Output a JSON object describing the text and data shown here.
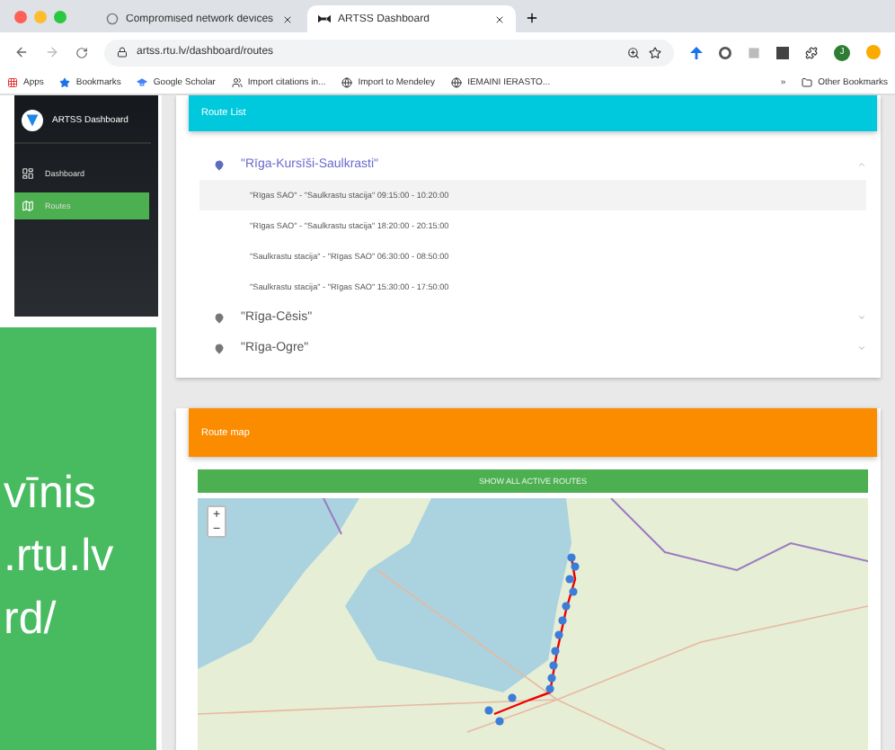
{
  "browser": {
    "tabs": [
      {
        "title": "Compromised network devices",
        "selected": false
      },
      {
        "title": "ARTSS Dashboard",
        "selected": true
      }
    ],
    "url": "artss.rtu.lv/dashboard/routes",
    "profile_initial": "J",
    "bookmarks": [
      {
        "label": "Apps",
        "kind": "apps"
      },
      {
        "label": "Bookmarks",
        "kind": "star"
      },
      {
        "label": "Google Scholar",
        "kind": "scholar"
      },
      {
        "label": "Import citations in...",
        "kind": "people"
      },
      {
        "label": "Import to Mendeley",
        "kind": "globe"
      },
      {
        "label": "IEMAINI IERASTO...",
        "kind": "globe"
      }
    ],
    "more_bookmarks": "»",
    "other_bookmarks": "Other Bookmarks"
  },
  "sidebar": {
    "title": "ARTSS Dashboard",
    "items": [
      {
        "label": "Dashboard",
        "kind": "dashboard",
        "selected": false
      },
      {
        "label": "Routes",
        "kind": "map",
        "selected": true
      }
    ]
  },
  "slide_fragment": {
    "lines": [
      "vīnis",
      ".rtu.lv",
      "rd/"
    ]
  },
  "route_list": {
    "title": "Route List",
    "routes": [
      {
        "name": "\"Rīga-Kursīši-Saulkrasti\"",
        "expanded": true,
        "trips": [
          {
            "label": "\"Rīgas SAO\" - \"Saulkrastu stacija\" 09:15:00 - 10:20:00",
            "selected": true
          },
          {
            "label": "\"Rīgas SAO\" - \"Saulkrastu stacija\" 18:20:00 - 20:15:00",
            "selected": false
          },
          {
            "label": "\"Saulkrastu stacija\" - \"Rīgas SAO\" 06:30:00 - 08:50:00",
            "selected": false
          },
          {
            "label": "\"Saulkrastu stacija\" - \"Rīgas SAO\" 15:30:00 - 17:50:00",
            "selected": false
          }
        ]
      },
      {
        "name": "\"Rīga-Cēsis\"",
        "expanded": false
      },
      {
        "name": "\"Rīga-Ogre\"",
        "expanded": false
      }
    ]
  },
  "route_map": {
    "title": "Route map",
    "button": "SHOW ALL ACTIVE ROUTES",
    "zoom_in": "+",
    "zoom_out": "−"
  }
}
